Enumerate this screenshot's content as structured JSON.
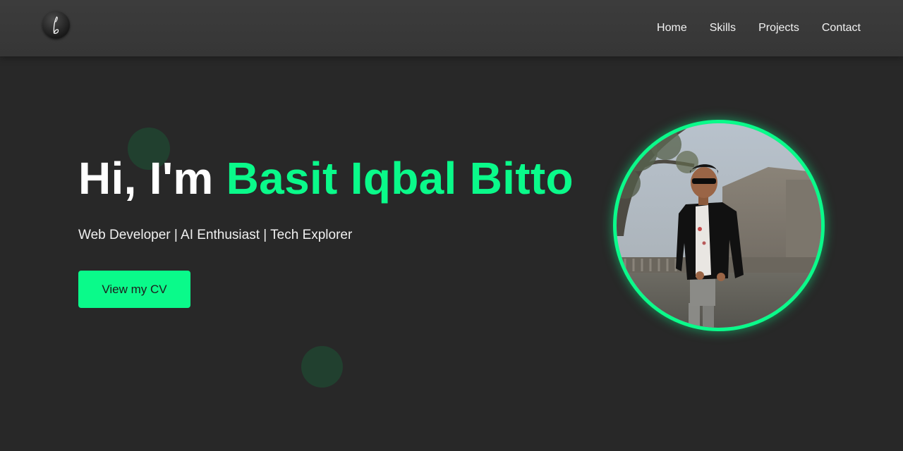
{
  "nav": {
    "logo_icon": "signature-b-logo",
    "links": [
      "Home",
      "Skills",
      "Projects",
      "Contact"
    ]
  },
  "hero": {
    "greeting": "Hi, I'm ",
    "name": "Basit Iqbal Bitto",
    "tagline": "Web Developer | AI Enthusiast | Tech Explorer",
    "cv_button": "View my CV",
    "profile_image_alt": "profile photo"
  },
  "colors": {
    "accent": "#0afa8a",
    "background": "#282828",
    "navbar": "#393939",
    "text": "#ffffff"
  }
}
